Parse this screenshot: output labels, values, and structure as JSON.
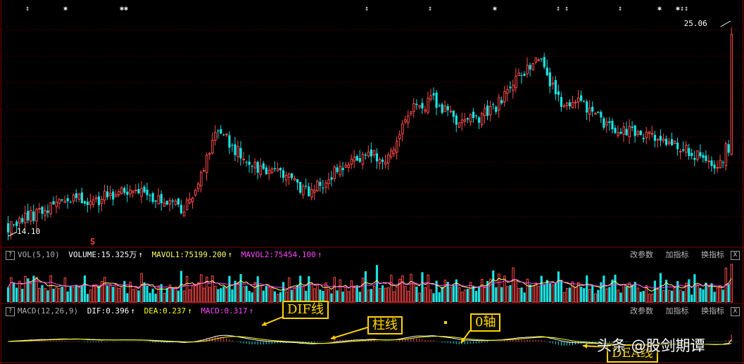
{
  "colors": {
    "background": "#000000",
    "grid": "#6b0000",
    "up": "#ff4a4a",
    "down": "#19e3e3",
    "mavol1": "#ffff66",
    "mavol2": "#ff44ff",
    "dif": "#ffffff",
    "dea": "#ffff00",
    "callout": "#ffd400"
  },
  "chart_data": [
    {
      "type": "candlestick",
      "title": "",
      "price_range": [
        13.2,
        26.6
      ],
      "start_close": 14.3,
      "n_bars": 256,
      "high_label": "25.06",
      "low_label": "14.10",
      "buy_sell_mark": "S",
      "event_markers": [
        "↕",
        "✱",
        "✱✱",
        "↕",
        "↕",
        "✱",
        "↕ ↕",
        "↕",
        "✱",
        "✱↕↕"
      ],
      "anchors": [
        {
          "i": 0,
          "close": 14.3
        },
        {
          "i": 10,
          "close": 15.0
        },
        {
          "i": 20,
          "close": 15.9
        },
        {
          "i": 30,
          "close": 15.7
        },
        {
          "i": 40,
          "close": 16.3
        },
        {
          "i": 50,
          "close": 16.0
        },
        {
          "i": 62,
          "close": 15.3
        },
        {
          "i": 68,
          "close": 17.1
        },
        {
          "i": 74,
          "close": 19.7
        },
        {
          "i": 80,
          "close": 18.6
        },
        {
          "i": 88,
          "close": 17.6
        },
        {
          "i": 97,
          "close": 17.3
        },
        {
          "i": 106,
          "close": 16.1
        },
        {
          "i": 116,
          "close": 17.4
        },
        {
          "i": 126,
          "close": 18.3
        },
        {
          "i": 134,
          "close": 18.1
        },
        {
          "i": 142,
          "close": 20.8
        },
        {
          "i": 150,
          "close": 21.3
        },
        {
          "i": 158,
          "close": 20.3
        },
        {
          "i": 164,
          "close": 20.2
        },
        {
          "i": 172,
          "close": 20.9
        },
        {
          "i": 180,
          "close": 22.7
        },
        {
          "i": 187,
          "close": 23.6
        },
        {
          "i": 194,
          "close": 21.3
        },
        {
          "i": 202,
          "close": 21.3
        },
        {
          "i": 210,
          "close": 20.0
        },
        {
          "i": 220,
          "close": 19.5
        },
        {
          "i": 230,
          "close": 19.1
        },
        {
          "i": 240,
          "close": 18.4
        },
        {
          "i": 248,
          "close": 17.8
        },
        {
          "i": 256,
          "close": 18.2
        }
      ]
    },
    {
      "type": "bar",
      "title": "VOL(5,10)",
      "series": [
        {
          "name": "VOLUME",
          "value": "15.325万"
        },
        {
          "name": "MAVOL1",
          "value": "75199.200"
        },
        {
          "name": "MAVOL2",
          "value": "75454.100"
        }
      ]
    },
    {
      "type": "bar",
      "title": "MACD(12,26,9)",
      "series": [
        {
          "name": "DIF",
          "value": "0.396"
        },
        {
          "name": "DEA",
          "value": "0.237"
        },
        {
          "name": "MACD",
          "value": "0.317"
        }
      ]
    }
  ],
  "vol_panel": {
    "question": "?",
    "label": "VOL(5,10)",
    "volume": "VOLUME:15.325万",
    "mavol1": "MAVOL1:75199.200",
    "mavol2": "MAVOL2:75454.100",
    "arrow": "↑"
  },
  "macd_panel": {
    "question": "?",
    "label": "MACD(12,26,9)",
    "dif": "DIF:0.396",
    "dea": "DEA:0.237",
    "macd": "MACD:0.317",
    "arrow": "↑"
  },
  "toolbar": {
    "edit_params": "改参数",
    "add_indicator": "加指标",
    "swap_indicator": "换指标",
    "close": "X"
  },
  "callouts": {
    "dif_line": "DIF线",
    "bar_line": "柱线",
    "zero_axis": "0轴",
    "dea_line": "DEA线"
  },
  "watermark": "头条 @股剑期谭"
}
